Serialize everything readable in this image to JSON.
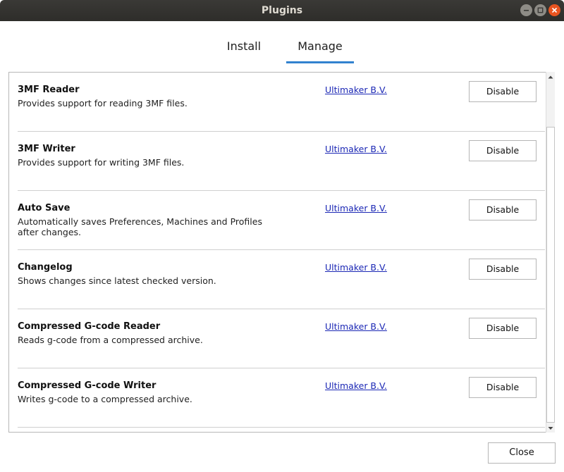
{
  "window": {
    "title": "Plugins"
  },
  "tabs": [
    {
      "label": "Install",
      "active": false
    },
    {
      "label": "Manage",
      "active": true
    }
  ],
  "plugins": [
    {
      "name": "3MF Reader",
      "description": "Provides support for reading 3MF files.",
      "author": "Ultimaker B.V.",
      "action": "Disable"
    },
    {
      "name": "3MF Writer",
      "description": "Provides support for writing 3MF files.",
      "author": "Ultimaker B.V.",
      "action": "Disable"
    },
    {
      "name": "Auto Save",
      "description": "Automatically saves Preferences, Machines and Profiles after changes.",
      "author": "Ultimaker B.V.",
      "action": "Disable"
    },
    {
      "name": "Changelog",
      "description": "Shows changes since latest checked version.",
      "author": "Ultimaker B.V.",
      "action": "Disable"
    },
    {
      "name": "Compressed G-code Reader",
      "description": "Reads g-code from a compressed archive.",
      "author": "Ultimaker B.V.",
      "action": "Disable"
    },
    {
      "name": "Compressed G-code Writer",
      "description": "Writes g-code to a compressed archive.",
      "author": "Ultimaker B.V.",
      "action": "Disable"
    }
  ],
  "footer": {
    "close_label": "Close"
  },
  "colors": {
    "titlebar": "#2e2d2a",
    "close_control": "#e95420",
    "active_tab_underline": "#3282cf",
    "link": "#1c28b5"
  },
  "icons": {
    "minimize": "minimize-icon",
    "maximize": "maximize-icon",
    "close": "close-icon",
    "scroll_up": "chevron-up-icon",
    "scroll_down": "chevron-down-icon"
  }
}
